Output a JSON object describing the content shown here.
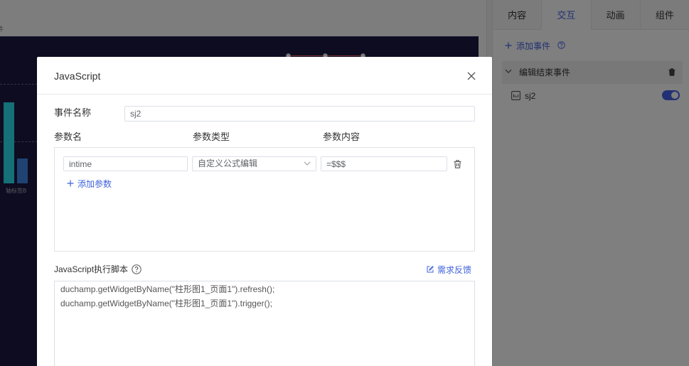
{
  "colors": {
    "accent": "#3f62db",
    "panel_accent": "#4462e6",
    "canvas_bg": "#1c1842",
    "bar_teal": "#2be0ee",
    "bar_blue": "#3f86e4",
    "backdrop": "rgba(0,0,0,0.5)"
  },
  "workspace": {
    "caption": "件",
    "chart": {
      "axis_label": "轴标签B"
    }
  },
  "right_panel": {
    "tabs": [
      {
        "label": "内容",
        "active": false
      },
      {
        "label": "交互",
        "active": true
      },
      {
        "label": "动画",
        "active": false
      },
      {
        "label": "组件",
        "active": false
      }
    ],
    "add_event_label": "添加事件",
    "event_group": {
      "title": "编辑结束事件",
      "expanded": true
    },
    "events": [
      {
        "name": "sj2",
        "enabled": true,
        "icon": "script-icon"
      }
    ]
  },
  "modal": {
    "title": "JavaScript",
    "event_name_label": "事件名称",
    "event_name_value": "sj2",
    "param_headers": {
      "name": "参数名",
      "type": "参数类型",
      "content": "参数内容"
    },
    "params": [
      {
        "name": "intime",
        "type": "自定义公式编辑",
        "content": "=$$$"
      }
    ],
    "add_param_label": "添加参数",
    "script_label": "JavaScript执行脚本",
    "feedback_label": "需求反馈",
    "script_lines": [
      "duchamp.getWidgetByName(\"柱形图1_页面1\").refresh();",
      "duchamp.getWidgetByName(\"柱形图1_页面1\").trigger();"
    ]
  },
  "icons": [
    "plus-icon",
    "help-circle-icon",
    "chevron-down-icon",
    "chevron-right-icon",
    "trash-icon",
    "script-icon",
    "close-icon",
    "edit-icon"
  ]
}
